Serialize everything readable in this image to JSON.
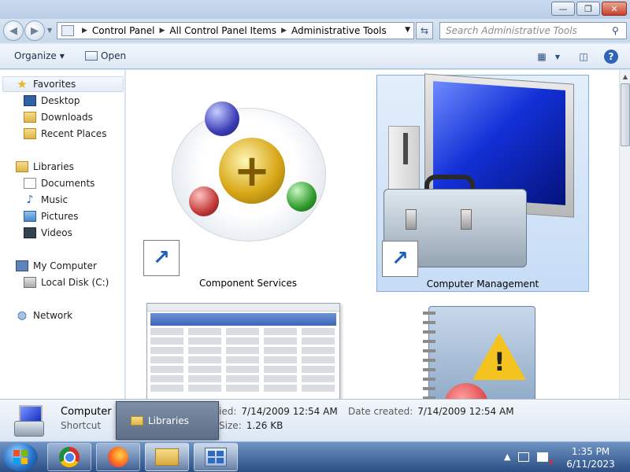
{
  "window": {
    "buttons": {
      "minimize": "—",
      "maximize": "❐",
      "close": "✕"
    }
  },
  "nav": {
    "breadcrumb": [
      "Control Panel",
      "All Control Panel Items",
      "Administrative Tools"
    ],
    "search_placeholder": "Search Administrative Tools"
  },
  "toolbar": {
    "organize_label": "Organize",
    "open_label": "Open"
  },
  "sidebar": {
    "favorites": {
      "label": "Favorites",
      "icon": "star-icon"
    },
    "favorite_items": [
      {
        "label": "Desktop",
        "icon": "desktop-icon"
      },
      {
        "label": "Downloads",
        "icon": "downloads-folder-icon"
      },
      {
        "label": "Recent Places",
        "icon": "recent-places-icon"
      }
    ],
    "libraries": {
      "label": "Libraries",
      "icon": "libraries-icon"
    },
    "library_items": [
      {
        "label": "Documents",
        "icon": "documents-icon"
      },
      {
        "label": "Music",
        "icon": "music-icon"
      },
      {
        "label": "Pictures",
        "icon": "pictures-icon"
      },
      {
        "label": "Videos",
        "icon": "videos-icon"
      }
    ],
    "computer": {
      "label": "My Computer",
      "icon": "computer-icon"
    },
    "computer_items": [
      {
        "label": "Local Disk (C:)",
        "icon": "local-disk-icon"
      }
    ],
    "network": {
      "label": "Network",
      "icon": "network-icon"
    }
  },
  "content": {
    "items": [
      {
        "label": "Component Services",
        "icon": "component-services-icon",
        "selected": false
      },
      {
        "label": "Computer Management",
        "icon": "computer-management-icon",
        "selected": true
      },
      {
        "label": "",
        "icon": "data-sources-icon",
        "selected": false
      },
      {
        "label": "",
        "icon": "event-viewer-icon",
        "selected": false
      }
    ]
  },
  "details": {
    "name": "Computer M",
    "type": "Shortcut",
    "modified_label": "ied:",
    "modified_value": "7/14/2009 12:54 AM",
    "created_label": "Date created:",
    "created_value": "7/14/2009 12:54 AM",
    "size_label": "Size:",
    "size_value": "1.26 KB"
  },
  "tooltip": {
    "label": "Libraries"
  },
  "taskbar": {
    "apps": [
      "Google Chrome",
      "Firefox",
      "Windows Explorer",
      "Control Panel"
    ],
    "time": "1:35 PM",
    "date": "6/11/2023"
  },
  "colors": {
    "accent": "#2b4f84",
    "selection": "#c6dcf5",
    "title_bar": "#c9daee"
  }
}
